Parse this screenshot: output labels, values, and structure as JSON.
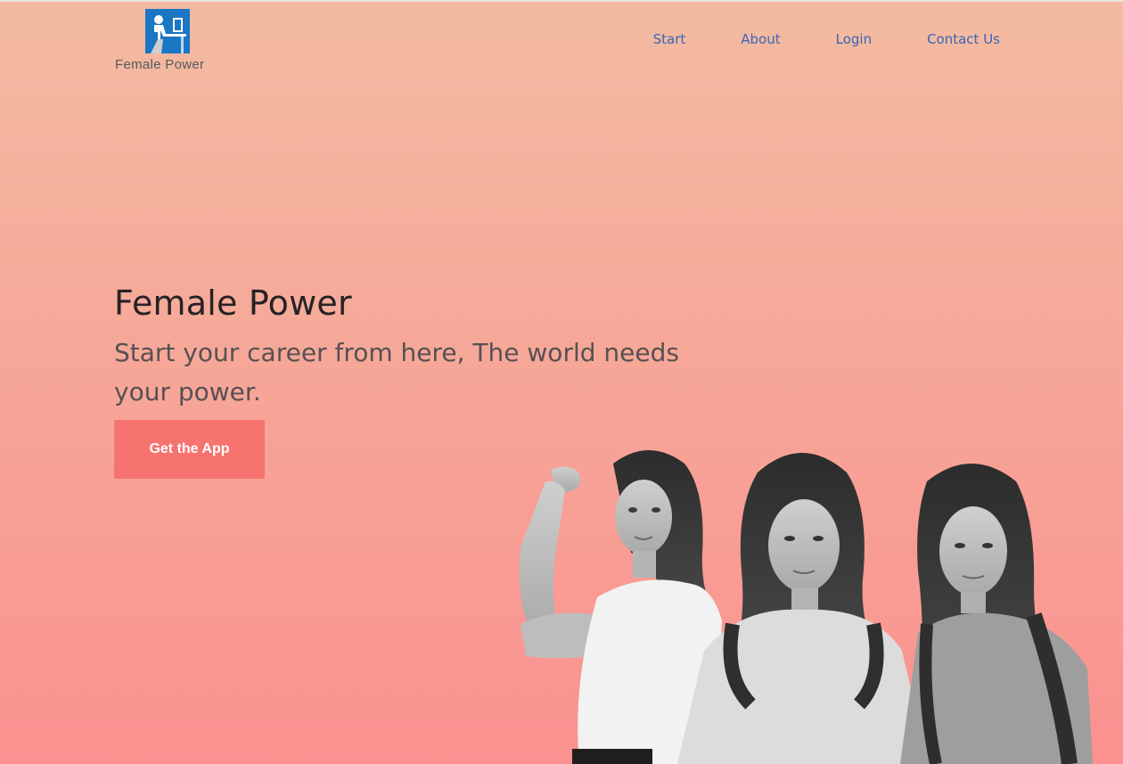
{
  "header": {
    "logo_text": "Female Power",
    "logo_icon": "person-at-computer-icon",
    "nav": [
      {
        "label": "Start"
      },
      {
        "label": "About"
      },
      {
        "label": "Login"
      },
      {
        "label": "Contact Us"
      }
    ]
  },
  "hero": {
    "title": "Female Power",
    "subtitle": "Start your career from here, The world needs your power.",
    "cta_label": "Get the App"
  },
  "colors": {
    "gradient_top": "#f3bba2",
    "gradient_bottom": "#fb9190",
    "cta_bg": "#f6736f",
    "nav_link": "#3867b4",
    "logo_blue": "#1b76c4"
  }
}
